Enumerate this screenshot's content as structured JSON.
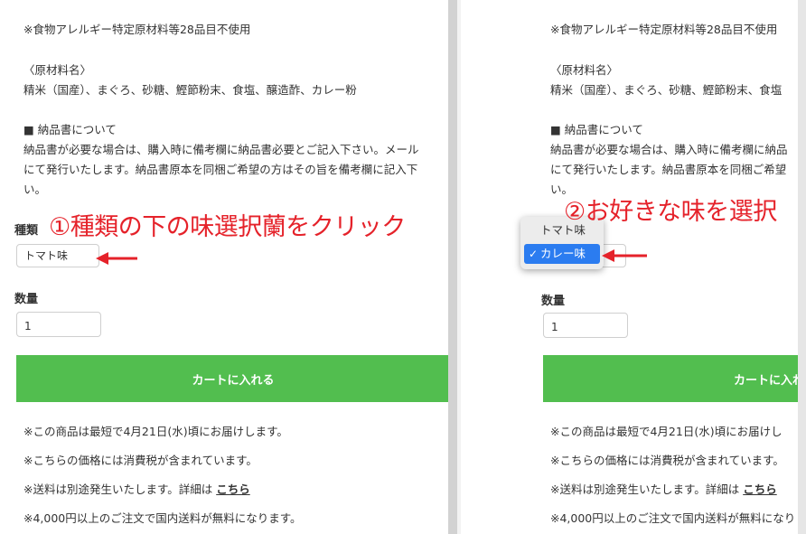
{
  "left": {
    "allergen_note": "※食物アレルギー特定原材料等28品目不使用",
    "ingredients_heading": "〈原材料名〉",
    "ingredients_text": "精米（国産）、まぐろ、砂糖、鰹節粉末、食塩、醸造酢、カレー粉",
    "invoice_heading": "■ 納品書について",
    "invoice_line1": "納品書が必要な場合は、購入時に備考欄に納品書必要とご記入下さい。メール",
    "invoice_line2": "にて発行いたします。納品書原本を同梱ご希望の方はその旨を備考欄に記入下",
    "invoice_line3": "い。",
    "variant_label": "種類",
    "variant_value": "トマト味",
    "quantity_label": "数量",
    "quantity_value": "1",
    "cart_button": "カートに入れる",
    "shipping_date": "※この商品は最短で4月21日(水)頃にお届けします。",
    "tax_note": "※こちらの価格には消費税が含まれています。",
    "shipping_fee_prefix": "※送料は別途発生いたします。詳細は ",
    "shipping_fee_link": "こちら",
    "free_shipping": "※4,000円以上のご注文で国内送料が無料になります。",
    "annotation": "①種類の下の味選択蘭をクリック"
  },
  "right": {
    "allergen_note": "※食物アレルギー特定原材料等28品目不使用",
    "ingredients_heading": "〈原材料名〉",
    "ingredients_text": "精米（国産）、まぐろ、砂糖、鰹節粉末、食塩",
    "invoice_heading": "■ 納品書について",
    "invoice_line1": "納品書が必要な場合は、購入時に備考欄に納品",
    "invoice_line2": "にて発行いたします。納品書原本を同梱ご希望",
    "invoice_line3": "い。",
    "quantity_label": "数量",
    "quantity_value": "1",
    "cart_button": "カートに入れ",
    "shipping_date": "※この商品は最短で4月21日(水)頃にお届けし",
    "tax_note": "※こちらの価格には消費税が含まれています。",
    "shipping_fee_prefix": "※送料は別途発生いたします。詳細は ",
    "shipping_fee_link": "こちら",
    "free_shipping": "※4,000円以上のご注文で国内送料が無料になり",
    "annotation": "②お好きな味を選択",
    "dropdown_options": [
      "トマト味",
      "カレー味"
    ],
    "dropdown_selected": "カレー味",
    "check_mark": "✓"
  },
  "colors": {
    "annotation": "#e5222a",
    "cart_button": "#52be4f",
    "dropdown_highlight": "#2b7cf0"
  }
}
